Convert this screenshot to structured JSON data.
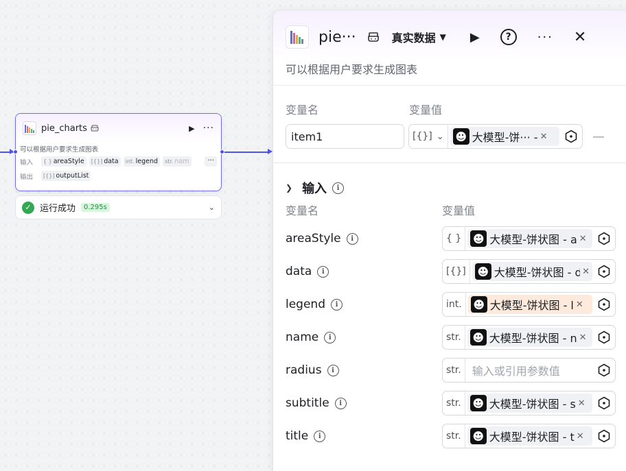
{
  "node": {
    "title": "pie_charts",
    "description": "可以根据用户要求生成图表",
    "input_label": "输入",
    "output_label": "输出",
    "inputs": [
      {
        "type": "{ }",
        "name": "areaStyle"
      },
      {
        "type": "[{}]",
        "name": "data"
      },
      {
        "type": "int.",
        "name": "legend"
      },
      {
        "type": "str.",
        "name": "nam"
      }
    ],
    "more_label": "···",
    "outputs": [
      {
        "type": "[{}]",
        "name": "outputList"
      }
    ]
  },
  "status": {
    "text": "运行成功",
    "time": "0.295s"
  },
  "panel": {
    "title": "pie···",
    "mode": "真实数据",
    "description": "可以根据用户要求生成图表",
    "output_section": {
      "col_name": "变量名",
      "col_value": "变量值",
      "var_name": "item1",
      "var_type": "[{}]",
      "var_ref": "大模型-饼··· -"
    },
    "input_section": {
      "title": "输入",
      "col_name": "变量名",
      "col_value": "变量值",
      "rows": [
        {
          "name": "areaStyle",
          "type": "{ }",
          "ref": "大模型-饼状图 - a"
        },
        {
          "name": "data",
          "type": "[{}]",
          "ref": "大模型-饼状图 - d"
        },
        {
          "name": "legend",
          "type": "int.",
          "ref": "大模型-饼状图 - l"
        },
        {
          "name": "name",
          "type": "str.",
          "ref": "大模型-饼状图 - n"
        },
        {
          "name": "radius",
          "type": "str.",
          "placeholder": "输入或引用参数值"
        },
        {
          "name": "subtitle",
          "type": "str.",
          "ref": "大模型-饼状图 - s"
        },
        {
          "name": "title",
          "type": "str.",
          "ref": "大模型-饼状图 - t"
        }
      ]
    }
  }
}
